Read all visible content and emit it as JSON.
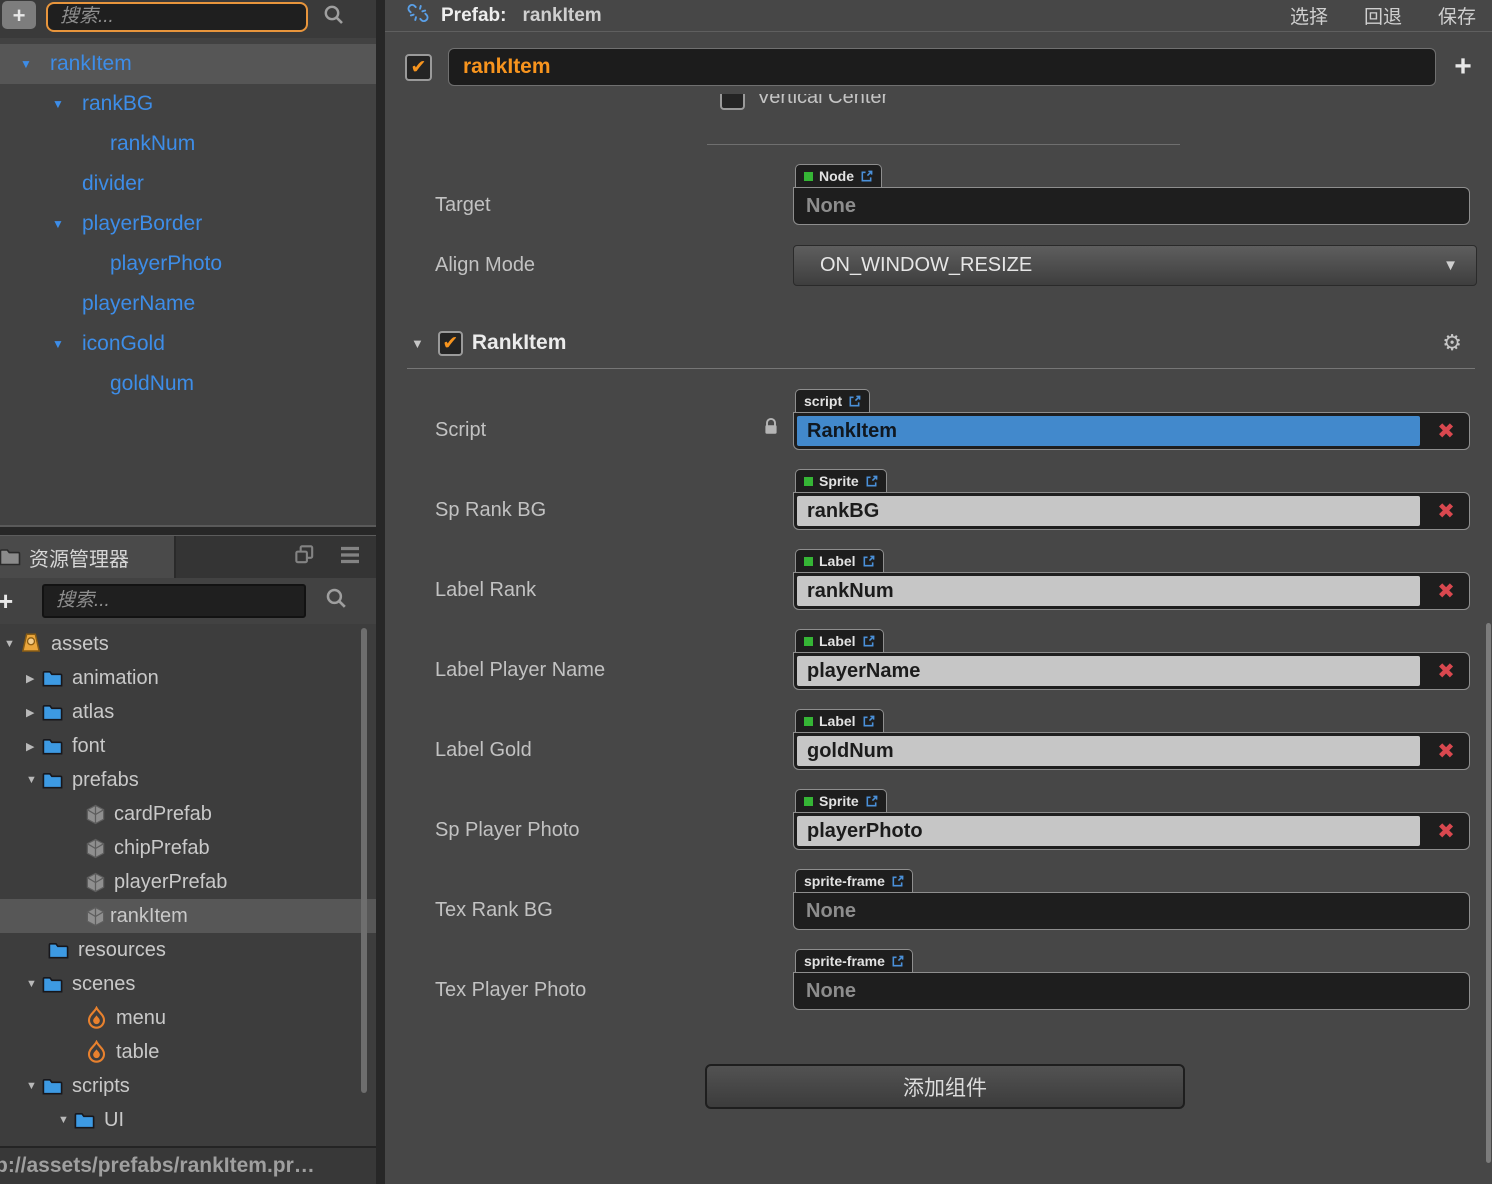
{
  "colors": {
    "accent_orange": "#F7941E",
    "hierarchy_blue": "#3D8DE8",
    "script_field_blue": "#4289CC",
    "remove_red": "#D9484F",
    "component_green": "#35B535"
  },
  "hierarchy": {
    "search_placeholder": "搜索...",
    "items": [
      {
        "label": "rankItem",
        "selected": true,
        "expanded": true
      },
      {
        "label": "rankBG",
        "expanded": true
      },
      {
        "label": "rankNum"
      },
      {
        "label": "divider"
      },
      {
        "label": "playerBorder",
        "expanded": true
      },
      {
        "label": "playerPhoto"
      },
      {
        "label": "playerName"
      },
      {
        "label": "iconGold",
        "expanded": true
      },
      {
        "label": "goldNum"
      }
    ]
  },
  "assets_panel": {
    "title": "资源管理器",
    "search_placeholder": "搜索...",
    "items": [
      {
        "label": "assets",
        "expanded": true
      },
      {
        "label": "animation"
      },
      {
        "label": "atlas"
      },
      {
        "label": "font"
      },
      {
        "label": "prefabs",
        "expanded": true
      },
      {
        "label": "cardPrefab"
      },
      {
        "label": "chipPrefab"
      },
      {
        "label": "playerPrefab"
      },
      {
        "label": "rankItem",
        "selected": true
      },
      {
        "label": "resources"
      },
      {
        "label": "scenes",
        "expanded": true
      },
      {
        "label": "menu"
      },
      {
        "label": "table"
      },
      {
        "label": "scripts",
        "expanded": true
      },
      {
        "label": "UI",
        "expanded": true
      }
    ],
    "status_path": "b://assets/prefabs/rankItem.pr…"
  },
  "inspector": {
    "header": {
      "prefab_label": "Prefab:",
      "prefab_name": "rankItem",
      "action_select": "选择",
      "action_revert": "回退",
      "action_save": "保存"
    },
    "name_field": {
      "value": "rankItem",
      "add_button": "+"
    },
    "widget": {
      "vertical_center": "Vertical Center"
    },
    "target": {
      "label": "Target",
      "tag": "Node",
      "value": "None"
    },
    "align_mode": {
      "label": "Align Mode",
      "value": "ON_WINDOW_RESIZE"
    },
    "component": {
      "title": "RankItem",
      "rows": [
        {
          "label": "Script",
          "tag": "script",
          "value": "RankItem"
        },
        {
          "label": "Sp Rank BG",
          "tag": "Sprite",
          "value": "rankBG"
        },
        {
          "label": "Label Rank",
          "tag": "Label",
          "value": "rankNum"
        },
        {
          "label": "Label Player Name",
          "tag": "Label",
          "value": "playerName"
        },
        {
          "label": "Label Gold",
          "tag": "Label",
          "value": "goldNum"
        },
        {
          "label": "Sp Player Photo",
          "tag": "Sprite",
          "value": "playerPhoto"
        },
        {
          "label": "Tex Rank BG",
          "tag": "sprite-frame",
          "value": "None"
        },
        {
          "label": "Tex Player Photo",
          "tag": "sprite-frame",
          "value": "None"
        }
      ]
    },
    "add_component_label": "添加组件"
  }
}
